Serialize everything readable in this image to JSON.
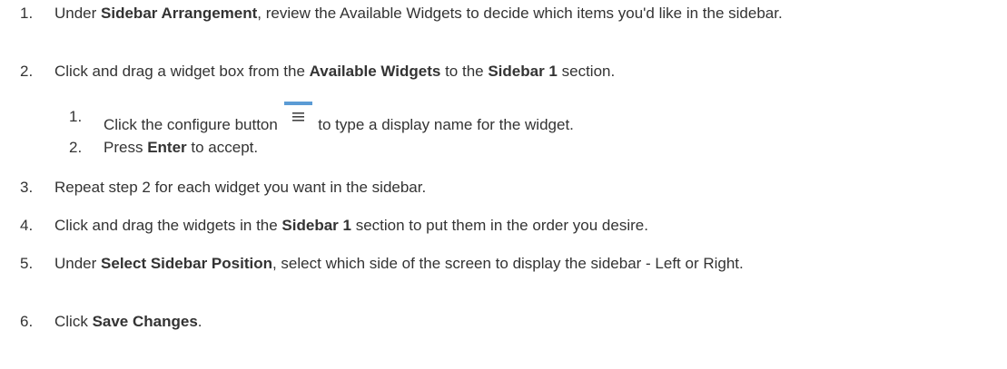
{
  "steps": [
    {
      "num": "1.",
      "parts": [
        "Under ",
        "Sidebar Arrangement",
        ", review the Available Widgets to decide which items you'd like in the sidebar."
      ]
    },
    {
      "num": "2.",
      "parts": [
        "Click and drag a widget box from the ",
        "Available Widgets",
        " to the ",
        "Sidebar 1",
        " section."
      ],
      "substeps": [
        {
          "num": "1.",
          "parts": [
            "Click the configure button ",
            " to type a display name for the widget."
          ],
          "icon": "menu-configure-icon"
        },
        {
          "num": "2.",
          "parts": [
            "Press ",
            "Enter",
            " to accept."
          ]
        }
      ]
    },
    {
      "num": "3.",
      "parts": [
        "Repeat step 2 for each widget you want in the sidebar."
      ]
    },
    {
      "num": "4.",
      "parts": [
        "Click and drag the widgets in the ",
        "Sidebar 1",
        " section to put them in the order you desire."
      ]
    },
    {
      "num": "5.",
      "parts": [
        "Under ",
        "Select Sidebar Position",
        ", select which side of the screen to display the sidebar - Left or Right."
      ]
    },
    {
      "num": "6.",
      "parts": [
        "Click ",
        "Save Changes",
        "."
      ]
    }
  ],
  "colors": {
    "text": "#333333",
    "icon_bar": "#5b9bd5",
    "icon_lines": "#444444"
  }
}
